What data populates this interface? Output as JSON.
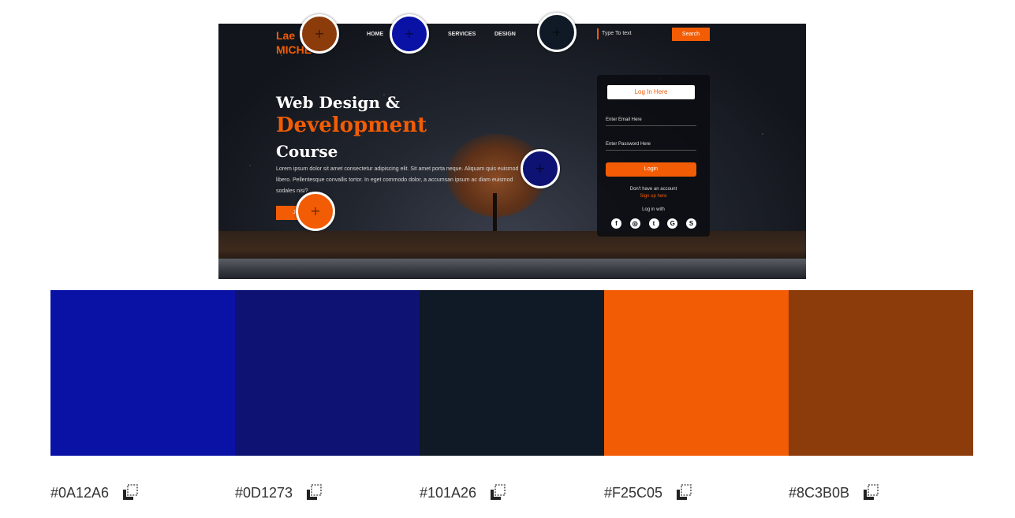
{
  "preview": {
    "logo_line1": "Lae",
    "logo_line2": "MICHE",
    "nav": [
      "HOME",
      "SERVICES",
      "DESIGN"
    ],
    "search_placeholder": "Type To text",
    "search_button": "Search",
    "hero_line1": "Web Design &",
    "hero_line2": "Development",
    "hero_line3": "Course",
    "hero_desc": "Lorem ipsum dolor sit amet consectetur adipiscing elit. Sit amet porta neque. Aliquam quis euismod libero. Pellentesque convallis tortor. In eget commodo dolor, a accumsan ipsum ac diam euismod sodales nisi?",
    "hero_button": "JOIN US",
    "login_title": "Log In Here",
    "email_placeholder": "Enter Email Here",
    "password_placeholder": "Enter Password Here",
    "login_button": "Login",
    "no_account": "Don't have an account",
    "signup_link": "Sign up here",
    "login_with": "Log in with",
    "social_icons": [
      "facebook-icon",
      "instagram-icon",
      "twitter-icon",
      "google-icon",
      "skype-icon"
    ],
    "social_glyphs": [
      "f",
      "◎",
      "t",
      "G",
      "S"
    ]
  },
  "markers": [
    {
      "color": "#8C3B0B"
    },
    {
      "color": "#0A12A6"
    },
    {
      "color": "#101A26"
    },
    {
      "color": "#0D1273"
    },
    {
      "color": "#F25C05"
    }
  ],
  "marker_glyph": "+",
  "palette": [
    {
      "hex": "#0A12A6"
    },
    {
      "hex": "#0D1273"
    },
    {
      "hex": "#101A26"
    },
    {
      "hex": "#F25C05"
    },
    {
      "hex": "#8C3B0B"
    }
  ],
  "copy_icon": "copy-icon"
}
